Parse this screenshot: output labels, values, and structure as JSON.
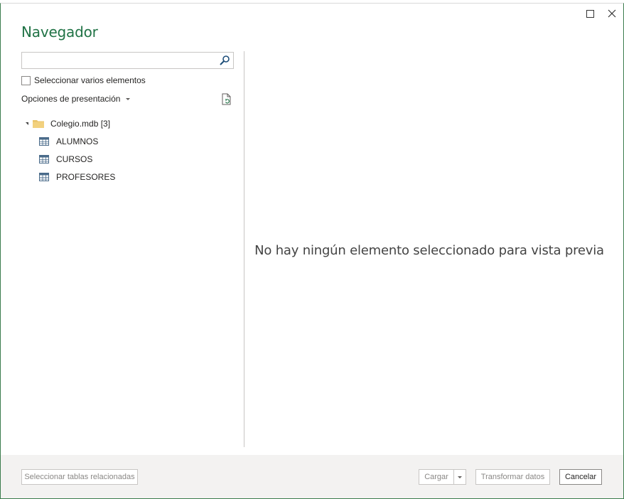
{
  "dialog": {
    "title": "Navegador"
  },
  "search": {
    "value": "",
    "placeholder": ""
  },
  "multi_select": {
    "label": "Seleccionar varios elementos",
    "checked": false
  },
  "display_options": {
    "label": "Opciones de presentación"
  },
  "tree": {
    "root": {
      "label": "Colegio.mdb [3]",
      "expanded": true
    },
    "items": [
      {
        "label": "ALUMNOS",
        "icon": "table-icon"
      },
      {
        "label": "CURSOS",
        "icon": "table-icon"
      },
      {
        "label": "PROFESORES",
        "icon": "table-icon"
      }
    ]
  },
  "preview": {
    "empty_message": "No hay ningún elemento seleccionado para vista previa"
  },
  "footer": {
    "related_tables_label": "Seleccionar tablas relacionadas",
    "load_label": "Cargar",
    "transform_label": "Transformar datos",
    "cancel_label": "Cancelar"
  },
  "colors": {
    "accent": "#217346",
    "border": "#3b7c4d",
    "footer_bg": "#f3f2f1"
  }
}
